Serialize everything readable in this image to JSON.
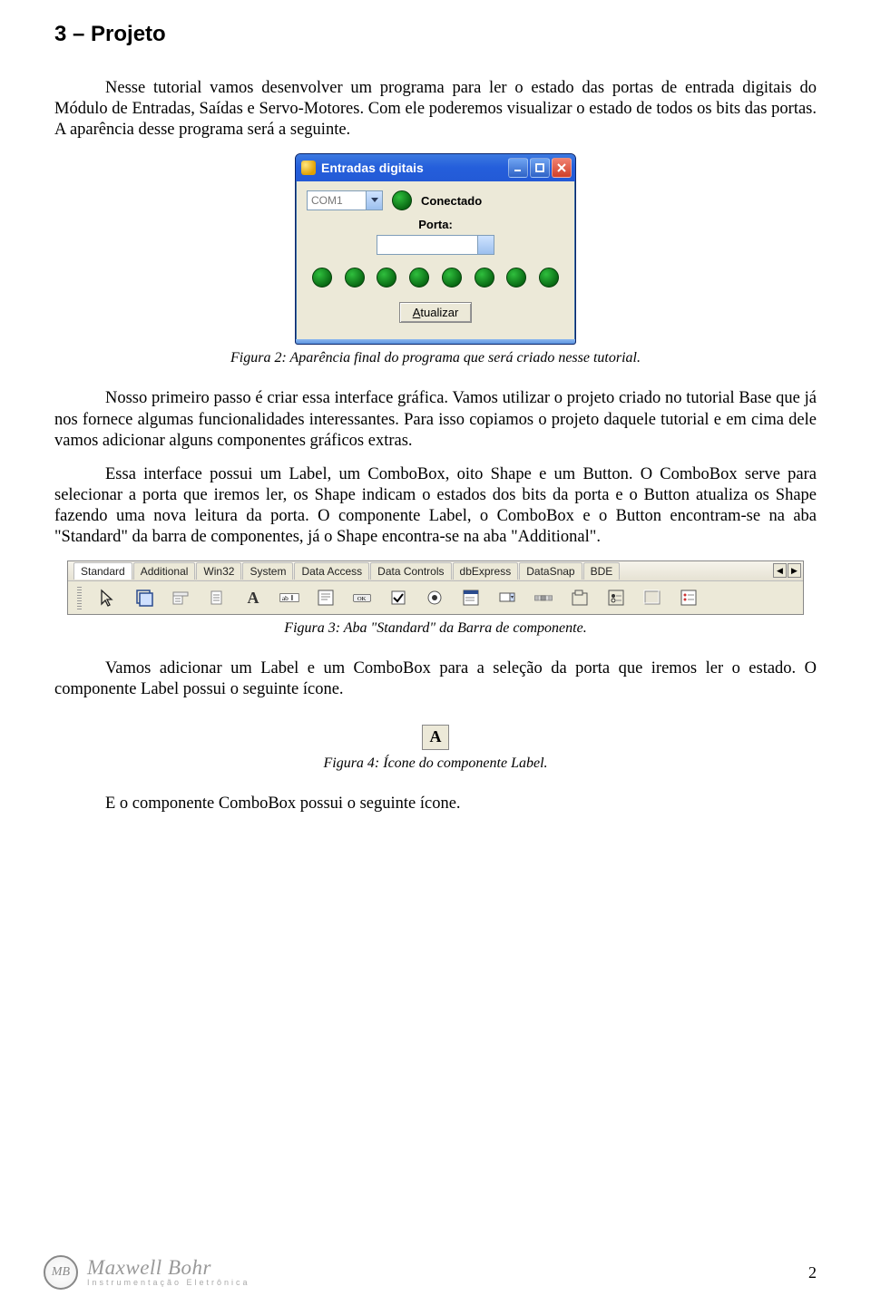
{
  "section_title": "3 – Projeto",
  "para1": "Nesse tutorial vamos desenvolver um programa para ler o estado das portas de entrada digitais do Módulo de Entradas, Saídas e Servo-Motores. Com ele poderemos visualizar o estado de todos os bits das portas. A aparência desse programa será a seguinte.",
  "fig2": {
    "window_title": "Entradas digitais",
    "com_value": "COM1",
    "status": "Conectado",
    "porta_label": "Porta:",
    "btn_update_prefix": "A",
    "btn_update_rest": "tualizar",
    "caption": "Figura 2: Aparência final do programa que será criado nesse tutorial."
  },
  "para2": "Nosso primeiro passo é criar essa interface gráfica. Vamos utilizar o projeto criado no tutorial Base que já nos fornece algumas funcionalidades interessantes. Para isso copiamos o projeto daquele tutorial e em cima dele vamos adicionar alguns componentes gráficos extras.",
  "para3": "Essa interface possui um Label, um ComboBox, oito Shape e um Button. O ComboBox serve para selecionar a porta que iremos ler, os Shape indicam o estados dos bits da porta e o Button atualiza os Shape fazendo uma nova leitura da porta. O componente Label, o ComboBox e o Button encontram-se na aba \"Standard\" da barra de componentes, já o Shape encontra-se na aba \"Additional\".",
  "fig3": {
    "tabs": [
      "Standard",
      "Additional",
      "Win32",
      "System",
      "Data Access",
      "Data Controls",
      "dbExpress",
      "DataSnap",
      "BDE"
    ],
    "icons": [
      "pointer",
      "frames",
      "popup-menu",
      "main-menu",
      "label-A",
      "edit-abI",
      "memo",
      "button-OK",
      "checkbox",
      "radio",
      "listbox",
      "combobox",
      "scrollbar",
      "groupbox",
      "radiogroup",
      "panel",
      "actionlist"
    ],
    "caption": "Figura 3: Aba \"Standard\" da Barra de componente."
  },
  "para4": "Vamos adicionar um Label e um ComboBox para a seleção da porta que iremos ler o estado. O componente Label possui o seguinte ícone.",
  "fig4": {
    "glyph": "A",
    "caption": "Figura 4: Ícone do componente Label."
  },
  "para5": "E o componente ComboBox possui o seguinte ícone.",
  "footer": {
    "brand": "Maxwell Bohr",
    "subtitle": "Instrumentação Eletrônica",
    "monogram": "MB",
    "page_number": "2"
  }
}
